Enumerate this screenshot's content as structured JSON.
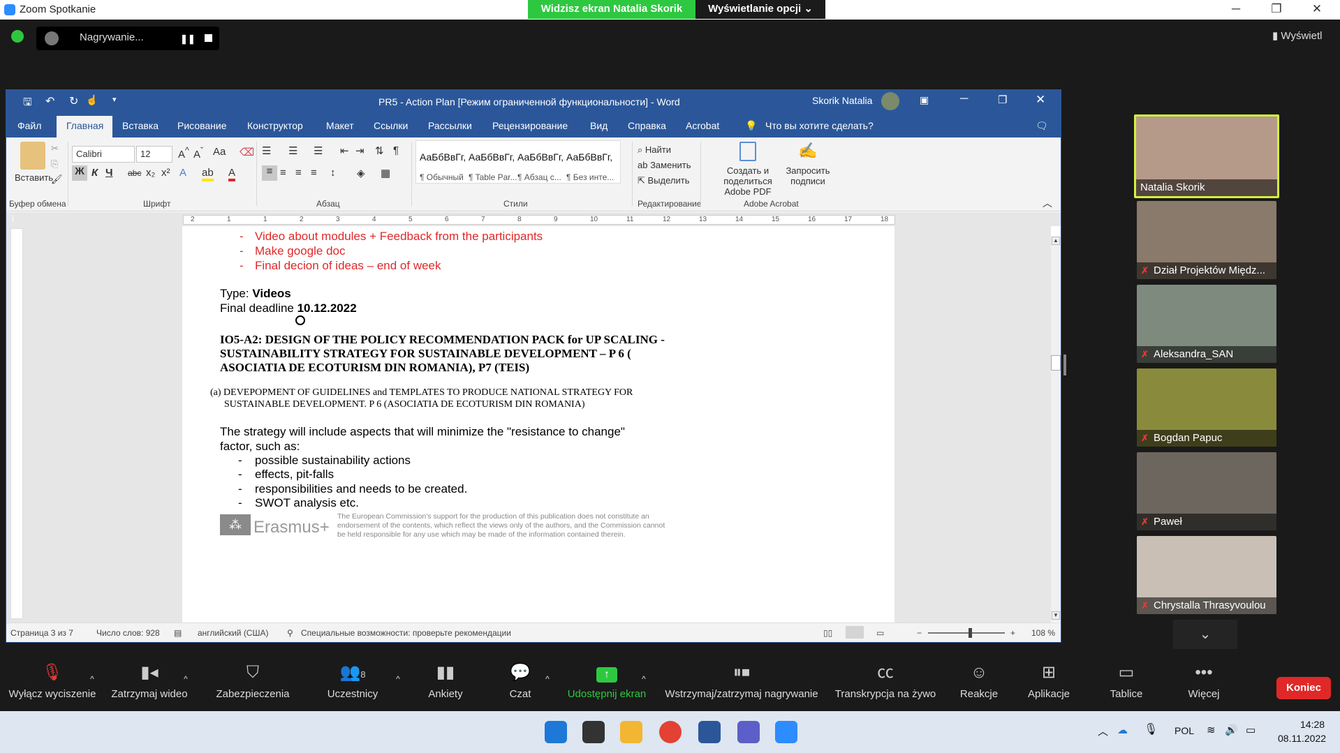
{
  "zoom": {
    "title": "Zoom Spotkanie",
    "share_banner": "Widzisz ekran Natalia Skorik",
    "view_options": "Wyświetlanie opcji",
    "recording": "Nagrywanie...",
    "view_button": "Wyświetl"
  },
  "word": {
    "title": "PR5 - Action Plan [Режим ограниченной функциональности]  -  Word",
    "user": "Skorik Natalia",
    "tabs": [
      "Файл",
      "Главная",
      "Вставка",
      "Рисование",
      "Конструктор",
      "Макет",
      "Ссылки",
      "Рассылки",
      "Рецензирование",
      "Вид",
      "Справка",
      "Acrobat"
    ],
    "tell_me": "Что вы хотите сделать?",
    "ribbon": {
      "paste": "Вставить",
      "clipboard": "Буфер обмена",
      "font_name": "Calibri",
      "font_size": "12",
      "font_group": "Шрифт",
      "paragraph": "Абзац",
      "styles_group": "Стили",
      "styles": [
        {
          "sample": "АаБбВвГг,",
          "label": "¶ Обычный"
        },
        {
          "sample": "АаБбВвГг,",
          "label": "¶ Table Par..."
        },
        {
          "sample": "АаБбВвГг,",
          "label": "¶ Абзац с..."
        },
        {
          "sample": "АаБбВвГг,",
          "label": "¶ Без инте..."
        }
      ],
      "find": "Найти",
      "replace": "Заменить",
      "select": "Выделить",
      "editing": "Редактирование",
      "create_pdf_1": "Создать и поделиться",
      "create_pdf_2": "Adobe PDF",
      "request_sign_1": "Запросить",
      "request_sign_2": "подписи",
      "acrobat_group": "Adobe Acrobat"
    },
    "ruler_marks": [
      "2",
      "1",
      "1",
      "2",
      "3",
      "4",
      "5",
      "6",
      "7",
      "8",
      "9",
      "10",
      "11",
      "12",
      "13",
      "14",
      "15",
      "16",
      "17",
      "18"
    ],
    "doc": {
      "red_items": [
        "Video about modules + Feedback from the participants",
        "Make google doc",
        "Final decion of ideas – end of week"
      ],
      "type_label": "Type: ",
      "type_value": "Videos",
      "deadline_label": "Final deadline ",
      "deadline_value": "10.12.2022",
      "heading": [
        "IO5-A2: DESIGN OF THE POLICY RECOMMENDATION PACK for UP SCALING -",
        "SUSTAINABILITY STRATEGY FOR SUSTAINABLE DEVELOPMENT – P 6 (",
        "ASOCIATIA DE ECOTURISM DIN ROMANIA), P7 (TEIS)"
      ],
      "sub": [
        "(a) DEVEPOPMENT OF GUIDELINES and TEMPLATES TO PRODUCE NATIONAL STRATEGY FOR",
        "SUSTAINABLE DEVELOPMENT.  P 6 (ASOCIATIA DE ECOTURISM DIN ROMANIA)"
      ],
      "para": [
        "The strategy will include aspects that will minimize the \"resistance to change\"",
        "factor, such as:"
      ],
      "bullets": [
        "possible sustainability actions",
        "effects, pit-falls",
        "responsibilities and needs to be created.",
        "SWOT analysis etc."
      ],
      "erasmus": "Erasmus+",
      "disclaimer": [
        "The European Commission's support for the production of this publication does not constitute an",
        "endorsement of the contents, which reflect the views only of the authors, and the Commission cannot",
        "be held responsible for any use which may be made of the information contained therein."
      ]
    },
    "status": {
      "page": "Страница 3 из 7",
      "words": "Число слов: 928",
      "lang": "английский (США)",
      "access": "Специальные возможности: проверьте рекомендации",
      "zoom": "108 %"
    }
  },
  "participants": [
    "Natalia Skorik",
    "Dział Projektów Międz...",
    "Aleksandra_SAN",
    "Bogdan Papuc",
    "Paweł",
    "Chrystalla Thrasyvoulou"
  ],
  "toolbar": [
    {
      "label": "Wyłącz wyciszenie",
      "icon": "mic-off-icon"
    },
    {
      "label": "Zatrzymaj wideo",
      "icon": "video-icon"
    },
    {
      "label": "Zabezpieczenia",
      "icon": "shield-icon"
    },
    {
      "label": "Uczestnicy",
      "icon": "participants-icon",
      "count": "8"
    },
    {
      "label": "Ankiety",
      "icon": "polls-icon"
    },
    {
      "label": "Czat",
      "icon": "chat-icon"
    },
    {
      "label": "Udostępnij ekran",
      "icon": "share-screen-icon"
    },
    {
      "label": "Wstrzymaj/zatrzymaj nagrywanie",
      "icon": "pause-record-icon"
    },
    {
      "label": "Transkrypcja na żywo",
      "icon": "cc-icon"
    },
    {
      "label": "Reakcje",
      "icon": "reactions-icon"
    },
    {
      "label": "Aplikacje",
      "icon": "apps-icon"
    },
    {
      "label": "Tablice",
      "icon": "whiteboard-icon"
    },
    {
      "label": "Więcej",
      "icon": "more-icon"
    }
  ],
  "end_button": "Koniec",
  "taskbar": {
    "lang": "POL",
    "time": "14:28",
    "date": "08.11.2022"
  },
  "colors": {
    "word_blue": "#2b579a",
    "zoom_green": "#2ec840",
    "end_red": "#e02828",
    "doc_red": "#e0282a"
  }
}
